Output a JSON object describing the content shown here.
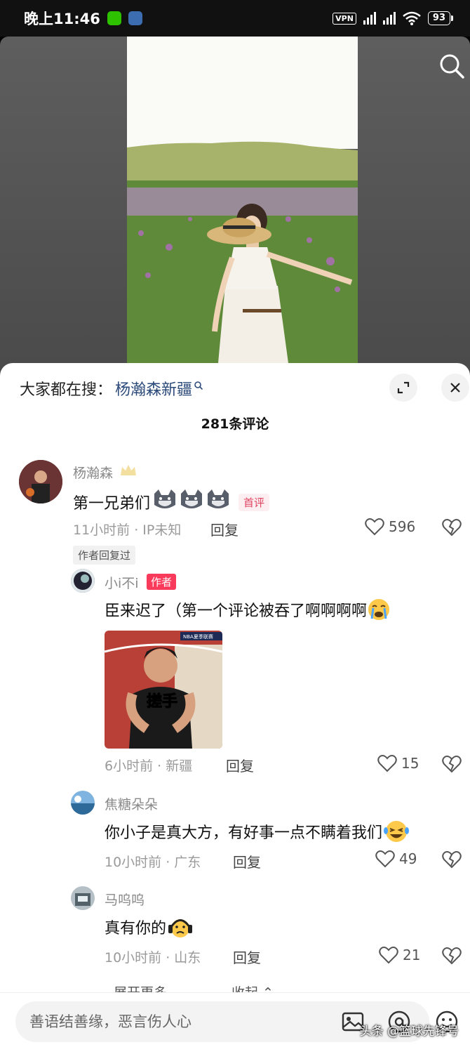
{
  "status_bar": {
    "time": "晚上11:46",
    "vpn": "VPN",
    "battery": "93"
  },
  "hot_search": {
    "prefix": "大家都在搜：",
    "term": "杨瀚森新疆"
  },
  "comment_count": "281条评论",
  "comments": [
    {
      "username": "杨瀚森",
      "text": "第一兄弟们",
      "tag": "首评",
      "time_location": "11小时前 · IP未知",
      "reply_label": "回复",
      "likes": "596",
      "author_replied": "作者回复过"
    }
  ],
  "replies": [
    {
      "username": "小i不i",
      "tag": "作者",
      "text": "臣来迟了（第一个评论被吞了啊啊啊啊",
      "image_caption": "搓手",
      "image_badge": "NBA夏季联赛",
      "time_location": "6小时前 · 新疆",
      "reply_label": "回复",
      "likes": "15"
    },
    {
      "username": "焦糖朵朵",
      "text": "你小子是真大方，有好事一点不瞒着我们",
      "time_location": "10小时前 · 广东",
      "reply_label": "回复",
      "likes": "49"
    },
    {
      "username": "马呜呜",
      "text": "真有你的",
      "time_location": "10小时前 · 山东",
      "reply_label": "回复",
      "likes": "21"
    }
  ],
  "expand_more": "展开更多 ⌄",
  "collapse": "收起 ⌃",
  "input_placeholder": "善语结善缘，恶言伤人心",
  "watermark": "头条 @篮球先锋号",
  "colors": {
    "accent_red": "#fa3a5b",
    "hot_search_blue": "#2b4a7a"
  }
}
